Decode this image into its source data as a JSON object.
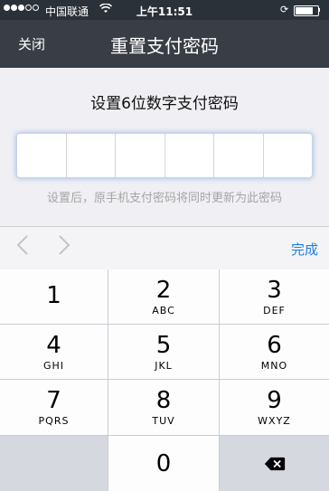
{
  "status_bar": {
    "carrier": "中国联通",
    "time": "上午11:51",
    "battery_level": 0.85
  },
  "nav": {
    "close_label": "关闭",
    "title": "重置支付密码"
  },
  "main": {
    "prompt": "设置6位数字支付密码",
    "pin_length": 6,
    "hint": "设置后，原手机支付密码将同时更新为此密码"
  },
  "toolbar": {
    "prev_icon": "chevron-left-icon",
    "next_icon": "chevron-right-icon",
    "done_label": "完成"
  },
  "keypad": {
    "keys": [
      {
        "num": "1",
        "letters": ""
      },
      {
        "num": "2",
        "letters": "ABC"
      },
      {
        "num": "3",
        "letters": "DEF"
      },
      {
        "num": "4",
        "letters": "GHI"
      },
      {
        "num": "5",
        "letters": "JKL"
      },
      {
        "num": "6",
        "letters": "MNO"
      },
      {
        "num": "7",
        "letters": "PQRS"
      },
      {
        "num": "8",
        "letters": "TUV"
      },
      {
        "num": "9",
        "letters": "WXYZ"
      },
      {
        "num": "0",
        "letters": ""
      }
    ],
    "delete_icon": "backspace-icon"
  },
  "colors": {
    "nav_bg": "#393e46",
    "accent": "#1f7de0",
    "hint": "#a6a6a6"
  }
}
